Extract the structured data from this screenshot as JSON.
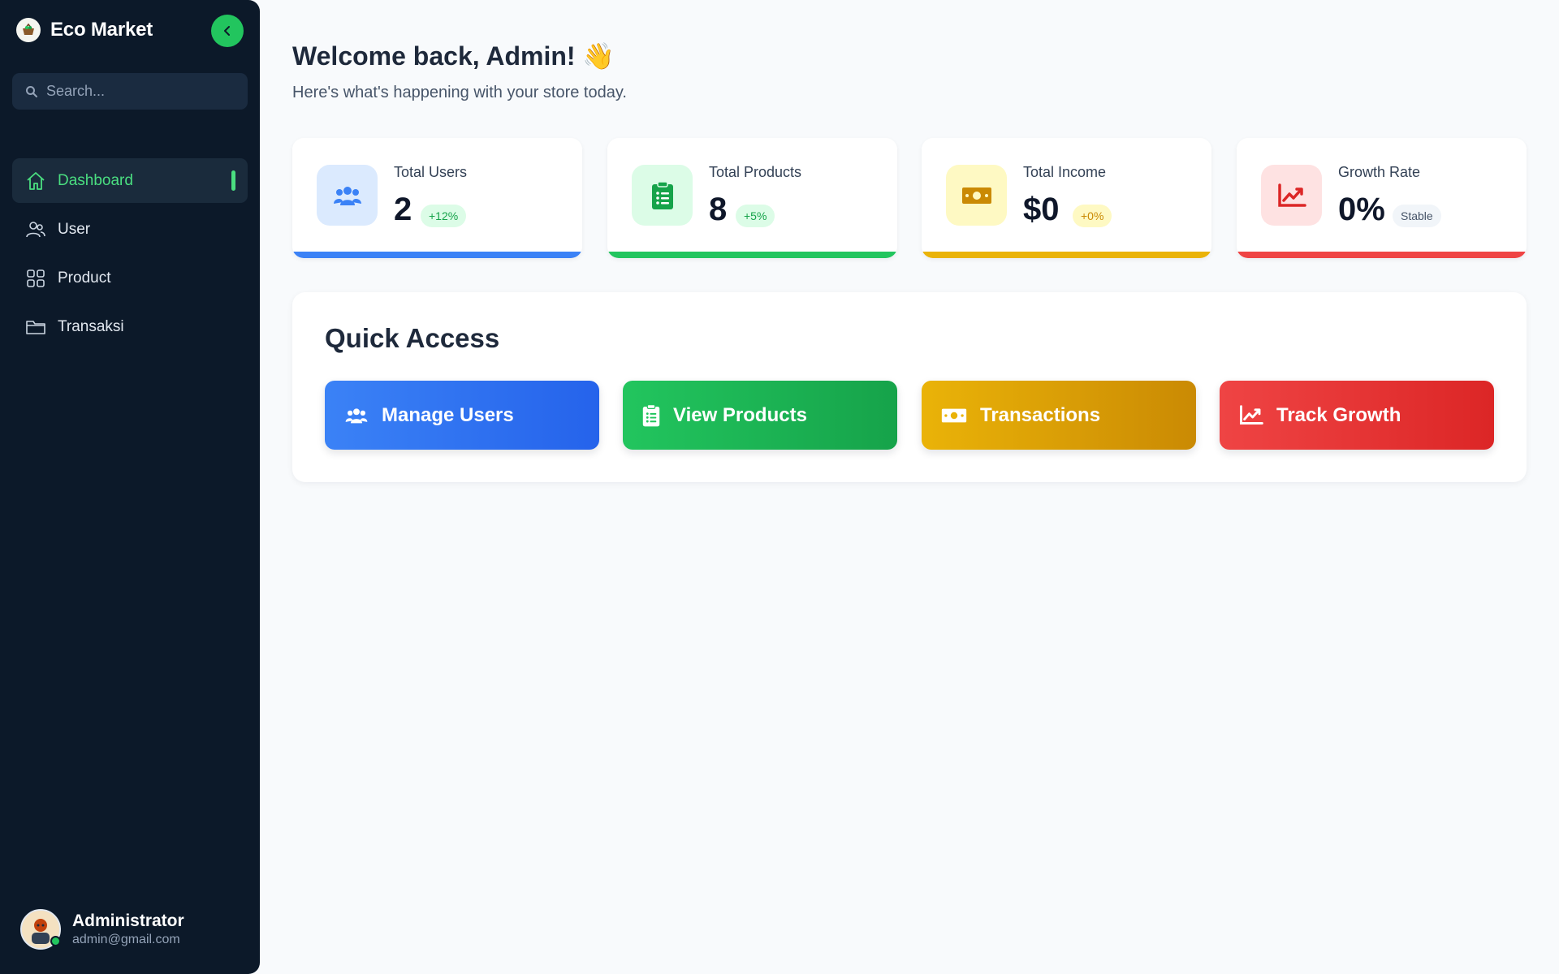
{
  "sidebar": {
    "brand": "Eco Market",
    "search_placeholder": "Search...",
    "items": [
      {
        "label": "Dashboard",
        "icon": "home-icon",
        "active": true
      },
      {
        "label": "User",
        "icon": "users-icon",
        "active": false
      },
      {
        "label": "Product",
        "icon": "grid-icon",
        "active": false
      },
      {
        "label": "Transaksi",
        "icon": "folder-icon",
        "active": false
      }
    ],
    "profile": {
      "name": "Administrator",
      "email": "admin@gmail.com"
    }
  },
  "header": {
    "title": "Welcome back, Admin! 👋",
    "subtitle": "Here's what's happening with your store today."
  },
  "stats": [
    {
      "label": "Total Users",
      "value": "2",
      "badge": "+12%",
      "icon": "users-icon",
      "color": "#3b82f6"
    },
    {
      "label": "Total Products",
      "value": "8",
      "badge": "+5%",
      "icon": "clipboard-list-icon",
      "color": "#22c55e"
    },
    {
      "label": "Total Income",
      "value": "$0",
      "badge": "+0%",
      "icon": "money-bill-icon",
      "color": "#eab308"
    },
    {
      "label": "Growth Rate",
      "value": "0%",
      "badge": "Stable",
      "icon": "chart-line-icon",
      "color": "#ef4444"
    }
  ],
  "quick_access": {
    "title": "Quick Access",
    "buttons": [
      {
        "label": "Manage Users",
        "icon": "users-icon",
        "color": "#3b82f6"
      },
      {
        "label": "View Products",
        "icon": "clipboard-list-icon",
        "color": "#22c55e"
      },
      {
        "label": "Transactions",
        "icon": "money-bill-icon",
        "color": "#eab308"
      },
      {
        "label": "Track Growth",
        "icon": "chart-line-icon",
        "color": "#ef4444"
      }
    ]
  }
}
